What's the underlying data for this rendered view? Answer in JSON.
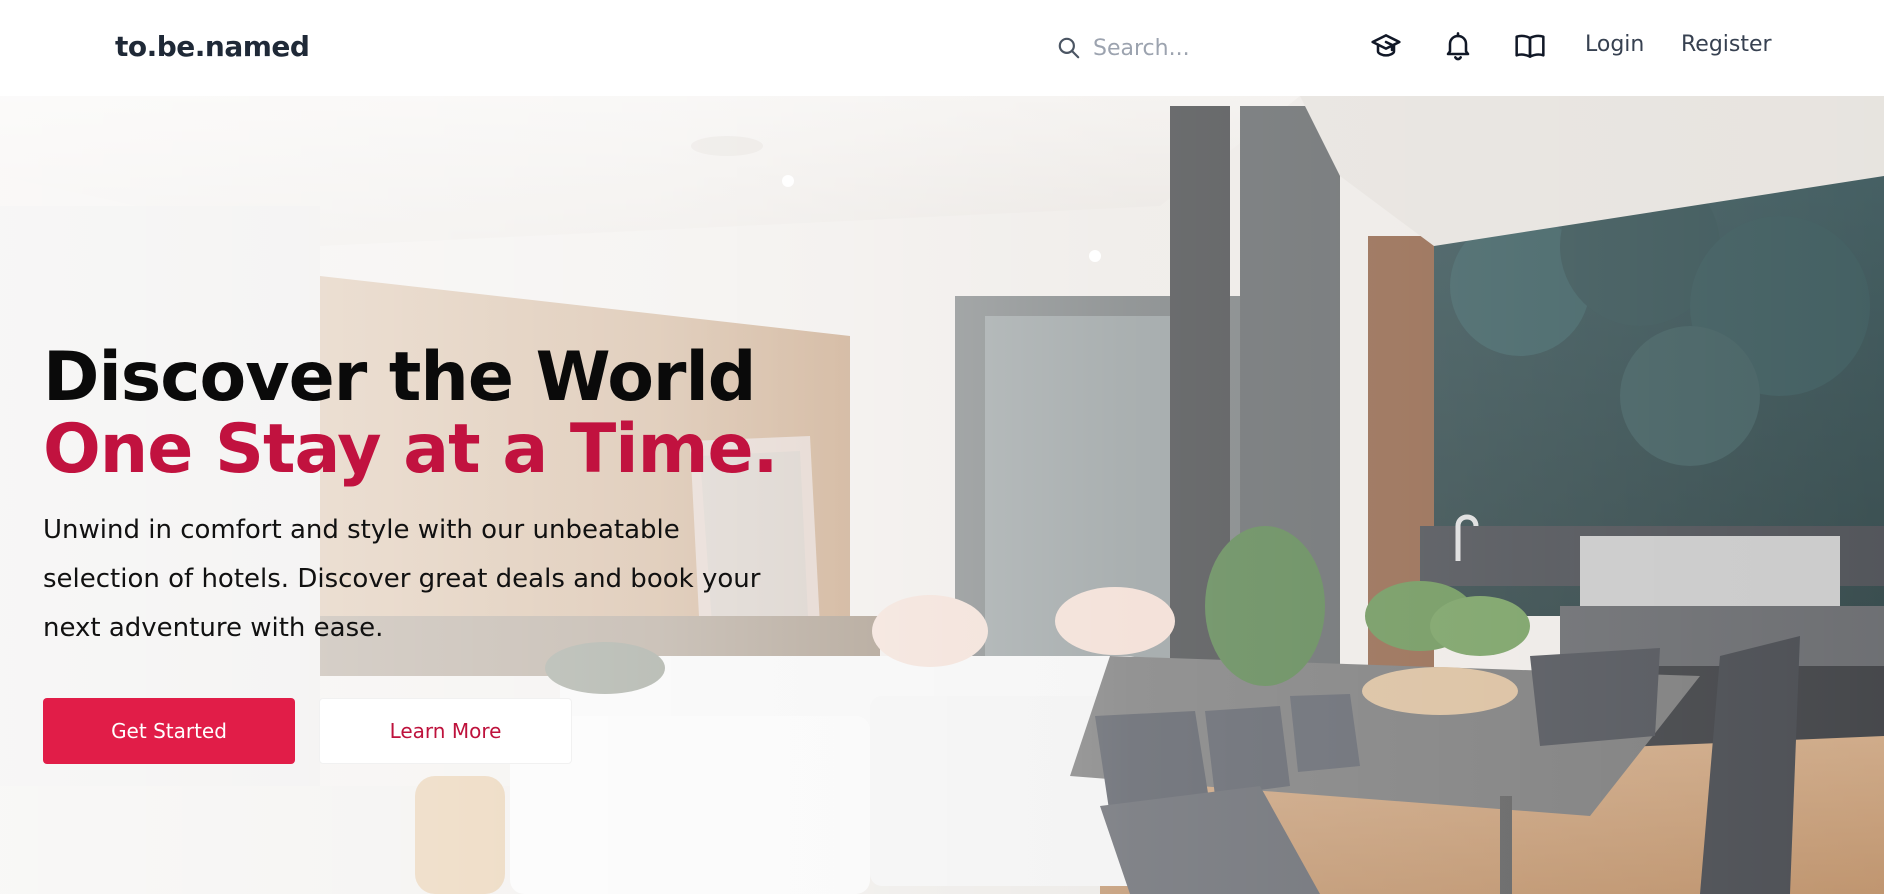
{
  "header": {
    "brand": "to.be.named",
    "search": {
      "placeholder": "Search..."
    },
    "icons": [
      "graduation-cap-icon",
      "bell-icon",
      "book-open-icon"
    ],
    "login_label": "Login",
    "register_label": "Register"
  },
  "hero": {
    "headline_line1": "Discover the World",
    "headline_line2": "One Stay at a Time.",
    "lead": "Unwind in comfort and style with our unbeatable selection of hotels. Discover great deals and book your next adventure with ease.",
    "primary_button": "Get Started",
    "secondary_button": "Learn More"
  },
  "colors": {
    "accent": "#e11d48",
    "headline_accent": "#c1123f",
    "text_dark": "#0a0a0a"
  }
}
